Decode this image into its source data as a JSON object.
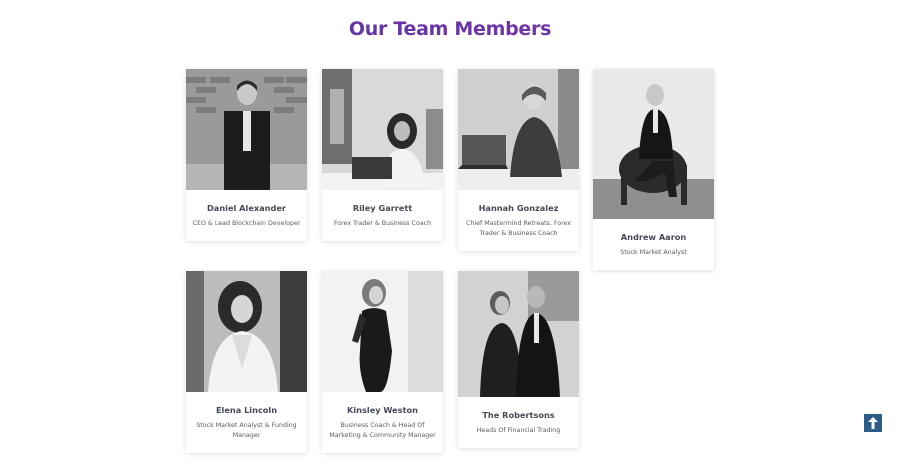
{
  "page": {
    "title": "Our Team Members"
  },
  "team": [
    {
      "name": "Daniel Alexander",
      "role": "CEO & Lead Blockchain Developer"
    },
    {
      "name": "Riley Garrett",
      "role": "Forex Trader & Business Coach"
    },
    {
      "name": "Hannah Gonzalez",
      "role": "Chief Mastermind Retreats, Forex Trader & Business Coach"
    },
    {
      "name": "Andrew Aaron",
      "role": "Stock Market Analyst"
    },
    {
      "name": "Elena Lincoln",
      "role": "Stock Market Analyst & Funding Manager"
    },
    {
      "name": "Kinsley Weston",
      "role": "Business Coach & Head Of Marketing & Community Manager"
    },
    {
      "name": "The Robertsons",
      "role": "Heads Of Financial Trading"
    }
  ],
  "scroll_top": {
    "icon": "arrow-up-icon",
    "color": "#2b5d86"
  }
}
